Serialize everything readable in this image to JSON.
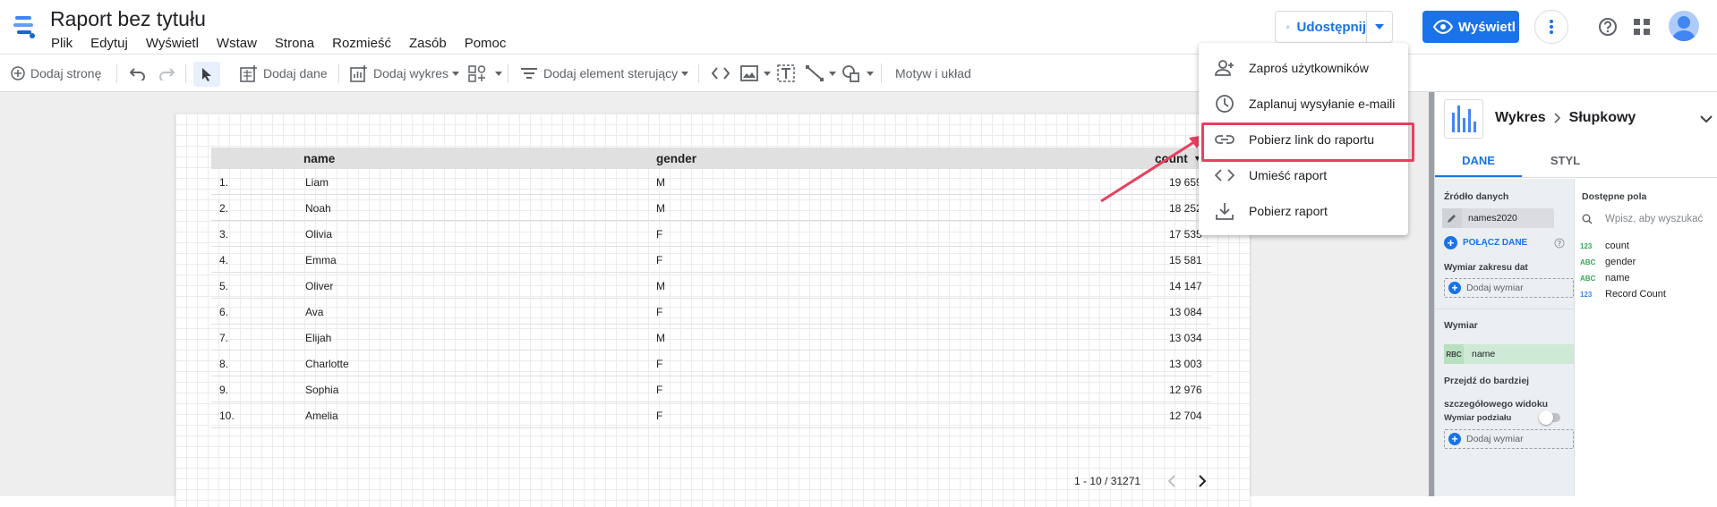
{
  "app": {
    "title": "Raport bez tytułu",
    "menu": [
      "Plik",
      "Edytuj",
      "Wyświetl",
      "Wstaw",
      "Strona",
      "Rozmieść",
      "Zasób",
      "Pomoc"
    ],
    "share_label": "Udostępnij",
    "view_label": "Wyświetl"
  },
  "toolbar": {
    "add_page": "Dodaj stronę",
    "add_data": "Dodaj dane",
    "add_chart": "Dodaj wykres",
    "add_control": "Dodaj element sterujący",
    "theme": "Motyw i układ"
  },
  "table": {
    "headers": [
      "name",
      "gender",
      "count"
    ],
    "sort_indicator": "▼",
    "rows": [
      {
        "idx": "1.",
        "name": "Liam",
        "gender": "M",
        "count": "19 659"
      },
      {
        "idx": "2.",
        "name": "Noah",
        "gender": "M",
        "count": "18 252"
      },
      {
        "idx": "3.",
        "name": "Olivia",
        "gender": "F",
        "count": "17 535"
      },
      {
        "idx": "4.",
        "name": "Emma",
        "gender": "F",
        "count": "15 581"
      },
      {
        "idx": "5.",
        "name": "Oliver",
        "gender": "M",
        "count": "14 147"
      },
      {
        "idx": "6.",
        "name": "Ava",
        "gender": "F",
        "count": "13 084"
      },
      {
        "idx": "7.",
        "name": "Elijah",
        "gender": "M",
        "count": "13 034"
      },
      {
        "idx": "8.",
        "name": "Charlotte",
        "gender": "F",
        "count": "13 003"
      },
      {
        "idx": "9.",
        "name": "Sophia",
        "gender": "F",
        "count": "12 976"
      },
      {
        "idx": "10.",
        "name": "Amelia",
        "gender": "F",
        "count": "12 704"
      }
    ],
    "pagination": "1 - 10 / 31271"
  },
  "share_menu": {
    "items": [
      {
        "label": "Zaproś użytkowników",
        "icon": "person-add-icon"
      },
      {
        "label": "Zaplanuj wysyłanie e-maili",
        "icon": "clock-icon"
      },
      {
        "label": "Pobierz link do raportu",
        "icon": "link-icon"
      },
      {
        "label": "Umieść raport",
        "icon": "embed-code-icon"
      },
      {
        "label": "Pobierz raport",
        "icon": "download-icon"
      }
    ],
    "highlighted_index": 2,
    "highlight_color": "#e8405f"
  },
  "panel": {
    "title_part1": "Wykres",
    "title_part2": "Słupkowy",
    "tabs": [
      "DANE",
      "STYL"
    ],
    "data_source_label": "Źródło danych",
    "data_source": "names2020",
    "connect_label": "POŁĄCZ DANE",
    "date_range_label": "Wymiar zakresu dat",
    "add_dimension": "Dodaj wymiar",
    "dimension_label": "Wymiar",
    "dimension_value": "name",
    "drill_label_1": "Przejdź do bardziej",
    "drill_label_2": "szczegółowego widoku",
    "breakdown_label": "Wymiar podziału",
    "available_fields_label": "Dostępne pola",
    "search_placeholder": "Wpisz, aby wyszukać",
    "fields": [
      {
        "type": "123",
        "name": "count"
      },
      {
        "type": "ABC",
        "name": "gender"
      },
      {
        "type": "ABC",
        "name": "name"
      },
      {
        "type": "123",
        "name": "Record Count"
      }
    ]
  },
  "colors": {
    "accent": "#1a73e8",
    "annotation": "#e8405f"
  }
}
